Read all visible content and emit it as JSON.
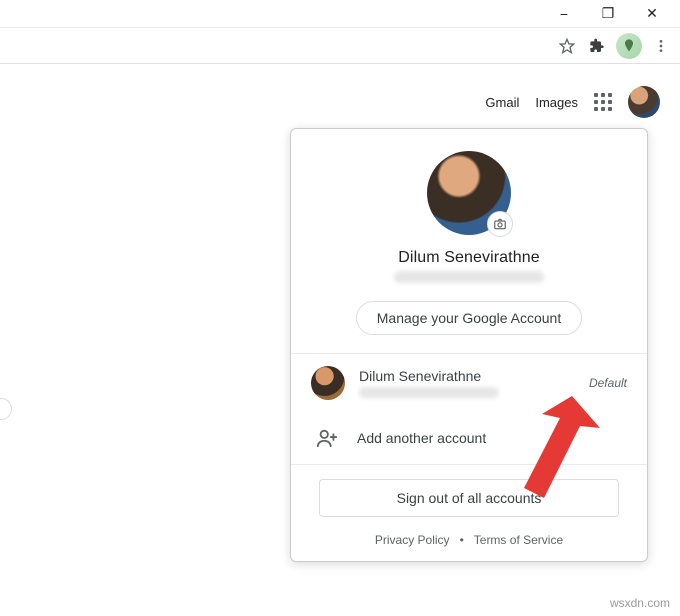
{
  "window_controls": {
    "minimize": "−",
    "maximize": "❐",
    "close": "✕"
  },
  "toolbar": {
    "star_icon": "star-icon",
    "ext_icon": "extensions-icon",
    "profile_icon": "profile-chip",
    "menu_icon": "menu-icon"
  },
  "ntp": {
    "gmail": "Gmail",
    "images": "Images"
  },
  "account_popup": {
    "user_name": "Dilum Senevirathne",
    "manage_label": "Manage your Google Account",
    "other_accounts": [
      {
        "name": "Dilum Senevirathne",
        "badge": "Default"
      }
    ],
    "add_account_label": "Add another account",
    "sign_out_label": "Sign out of all accounts",
    "privacy_label": "Privacy Policy",
    "terms_label": "Terms of Service"
  },
  "watermark": "wsxdn.com"
}
